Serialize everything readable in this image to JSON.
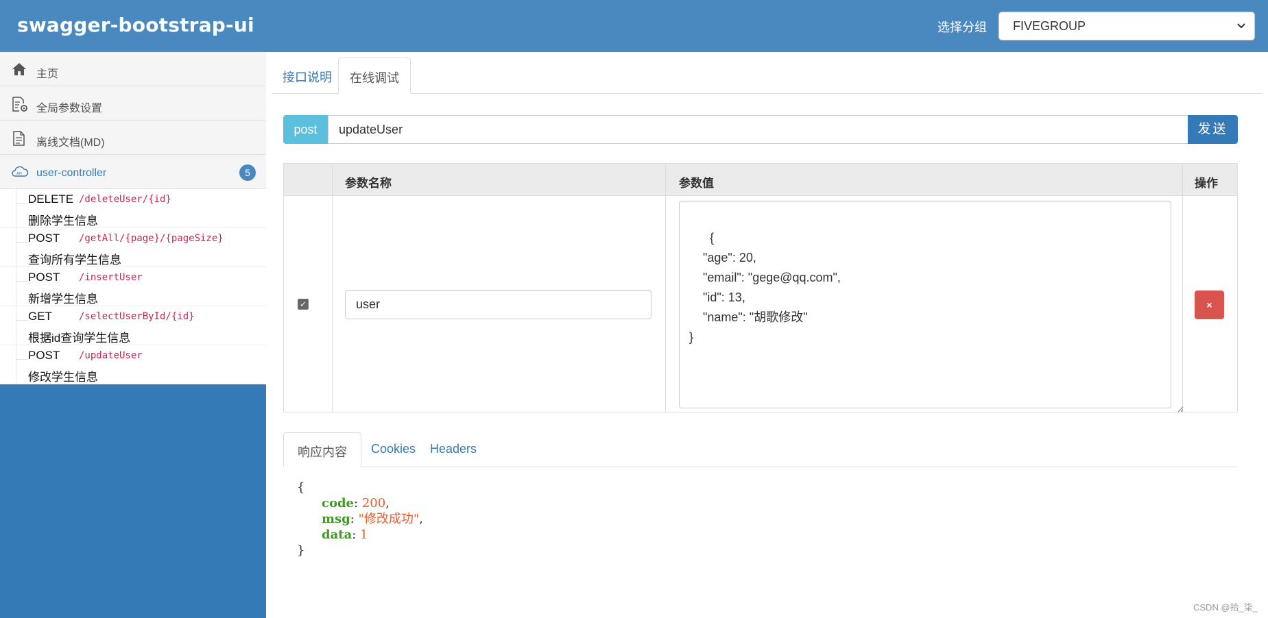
{
  "header": {
    "brand": "swagger-bootstrap-ui",
    "group_label": "选择分组",
    "group_value": "FIVEGROUP"
  },
  "sidebar": {
    "menu": [
      {
        "label": "主页",
        "icon": "home-icon"
      },
      {
        "label": "全局参数设置",
        "icon": "settings-doc-icon"
      },
      {
        "label": "离线文档(MD)",
        "icon": "document-icon"
      }
    ],
    "controller": {
      "label": "user-controller",
      "icon": "cloud-api-icon",
      "count": "5"
    },
    "apis": [
      {
        "method": "DELETE",
        "path": "/deleteUser/{id}",
        "desc": "删除学生信息"
      },
      {
        "method": "POST",
        "path": "/getAll/{page}/{pageSize}",
        "desc": "查询所有学生信息"
      },
      {
        "method": "POST",
        "path": "/insertUser",
        "desc": "新增学生信息"
      },
      {
        "method": "GET",
        "path": "/selectUserById/{id}",
        "desc": "根据id查询学生信息"
      },
      {
        "method": "POST",
        "path": "/updateUser",
        "desc": "修改学生信息"
      }
    ]
  },
  "main": {
    "tabs": [
      {
        "label": "接口说明"
      },
      {
        "label": "在线调试"
      }
    ],
    "request": {
      "method_tag": "post",
      "url": "updateUser",
      "send_label": "发送"
    },
    "params_table": {
      "headers": {
        "name": "参数名称",
        "value": "参数值",
        "action": "操作"
      },
      "row": {
        "checked": true,
        "name": "user",
        "value": "{\n    \"age\": 20,\n    \"email\": \"gege@qq.com\",\n    \"id\": 13,\n    \"name\": \"胡歌修改\"\n}",
        "delete_label": "×"
      }
    },
    "response_tabs": [
      {
        "label": "响应内容"
      },
      {
        "label": "Cookies"
      },
      {
        "label": "Headers"
      }
    ],
    "response": {
      "open": "{",
      "close": "}",
      "fields": [
        {
          "key": "code",
          "value": "200",
          "suffix": ","
        },
        {
          "key": "msg",
          "value": "\"修改成功\"",
          "suffix": ","
        },
        {
          "key": "data",
          "value": "1",
          "suffix": ""
        }
      ]
    }
  },
  "watermark": "CSDN @拾_柒_",
  "colors": {
    "header_bg": "#4a89c0",
    "sidebar_bg": "#337ab7",
    "post_tag": "#5bc0de",
    "send_btn": "#337ab7",
    "delete_btn": "#d9534f",
    "path_text": "#c7254e",
    "json_key": "#3c9c1f",
    "json_value": "#f05a28"
  }
}
